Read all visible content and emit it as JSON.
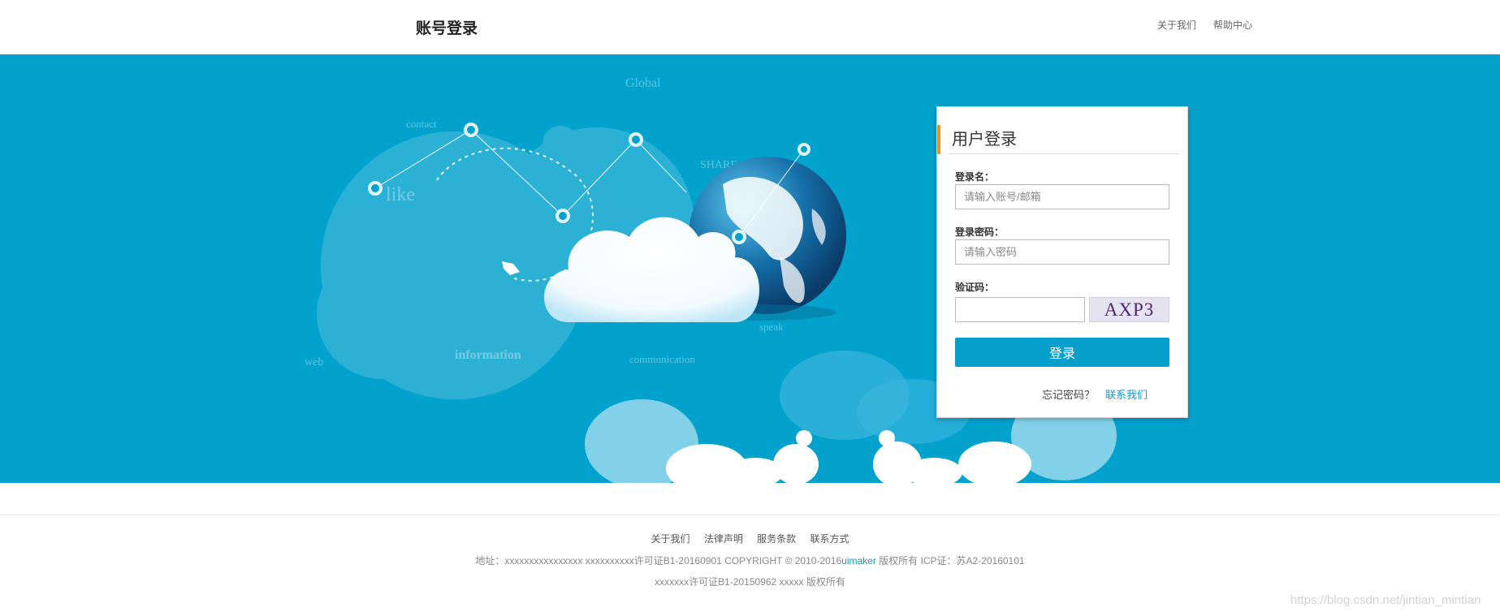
{
  "header": {
    "title": "账号登录",
    "nav": [
      "关于我们",
      "帮助中心"
    ]
  },
  "banner": {
    "illustration_words": [
      "Global",
      "contact",
      "like",
      "SHARE",
      "web",
      "information",
      "communication",
      "speak"
    ]
  },
  "login": {
    "title": "用户登录",
    "username_label": "登录名：",
    "username_placeholder": "请输入账号/邮箱",
    "password_label": "登录密码：",
    "password_placeholder": "请输入密码",
    "captcha_label": "验证码：",
    "captcha_code": "AXP3",
    "submit_label": "登录",
    "forgot_label": "忘记密码？",
    "contact_label": "联系我们"
  },
  "footer": {
    "links": [
      "关于我们",
      "法律声明",
      "服务条款",
      "联系方式"
    ],
    "line1_prefix": "地址：xxxxxxxxxxxxxxxx  xxxxxxxxxx许可证B1-20160901  COPYRIGHT  ©  2010-2016",
    "line1_brand": "uimaker",
    "line1_suffix": " 版权所有 ICP证：苏A2-20160101",
    "line2": "xxxxxxx许可证B1-20150962  xxxxx  版权所有"
  },
  "watermark": "https://blog.csdn.net/jintian_mintian",
  "colors": {
    "banner": "#03a2cd",
    "accent": "#f08e1c",
    "button": "#049fcb",
    "link": "#1a97c9"
  }
}
